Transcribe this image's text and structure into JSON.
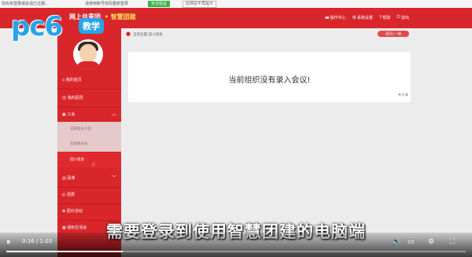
{
  "browser": {
    "text_left": "您尚未登录或会话已过期...",
    "text_mid": "请使用帐号密码重新登录",
    "button_primary": "安全验证",
    "button_secondary": "此网站不再提示"
  },
  "watermark": {
    "logo_text": "pc6",
    "badge_text": "教学"
  },
  "header": {
    "brand_title": "网上共青团",
    "brand_sub": "智慧团建",
    "menu": [
      {
        "icon": "monitor-icon",
        "glyph": "▬",
        "label": "操作中心"
      },
      {
        "icon": "gear-icon",
        "glyph": "⚙",
        "label": "系统设置"
      },
      {
        "icon": "help-icon",
        "glyph": "?",
        "label": "帮助"
      },
      {
        "icon": "power-icon",
        "glyph": "⏻",
        "label": "退出"
      }
    ]
  },
  "sidebar": {
    "items": [
      {
        "label": "我的首页",
        "glyph": "⌂"
      },
      {
        "label": "我的团员",
        "glyph": "☺"
      },
      {
        "label": "三会",
        "glyph": "▣",
        "chevron": "︿"
      }
    ],
    "sub_items": [
      {
        "label": "支部团员大会"
      },
      {
        "label": "支部委员会"
      },
      {
        "label": "团小组会"
      }
    ],
    "items_lower": [
      {
        "label": "团课",
        "glyph": "▤",
        "chevron": "﹀"
      },
      {
        "label": "团费",
        "glyph": "◎"
      },
      {
        "label": "团日活动",
        "glyph": "✿"
      },
      {
        "label": "组织生活会",
        "glyph": "▦"
      }
    ]
  },
  "content": {
    "breadcrumb": "当前位置:团小组会",
    "return_button": "返回上一级",
    "empty_message": "当前组织没有录入会议!",
    "total_count": "共 0 条"
  },
  "player": {
    "subtitle": "需要登录到使用智慧团建的电脑端",
    "time": "0:16 / 1:03",
    "progress": 0.254,
    "controls": {
      "prev": "⏮",
      "play": "⏸",
      "next": "⏭",
      "volume": "🔊",
      "subtitles": "▭",
      "settings": "⚙",
      "fullscreen": "⛶"
    }
  },
  "colors": {
    "brand_red": "#d8262b",
    "bg": "#ececec"
  }
}
